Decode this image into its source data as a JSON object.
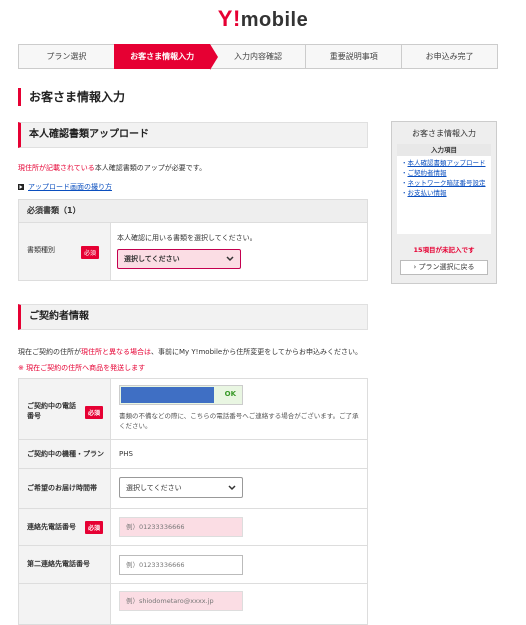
{
  "header": {
    "logo_y": "Y!",
    "logo_text": "mobile"
  },
  "steps": [
    {
      "label": "プラン選択"
    },
    {
      "label": "お客さま情報入力"
    },
    {
      "label": "入力内容確認"
    },
    {
      "label": "重要説明事項"
    },
    {
      "label": "お申込み完了"
    }
  ],
  "page_title": "お客さま情報入力",
  "upload": {
    "heading": "本人確認書類アップロード",
    "note_red": "現住所が記載されている",
    "note_rest": "本人確認書類のアップが必要です。",
    "link": "アップロード画面の撮り方",
    "table_head": "必須書類（1）",
    "doc_label": "書類種別",
    "required": "必須",
    "doc_hint": "本人確認に用いる書類を選択してください。",
    "doc_select": "選択してください"
  },
  "sidebar": {
    "title": "お客さま情報入力",
    "box_head": "入力項目",
    "items": [
      "本人確認書類アップロード",
      "ご契約者情報",
      "ネットワーク暗証番号設定",
      "お支払い情報"
    ],
    "warning": "15項目が未記入です",
    "back_button": "プラン選択に戻る"
  },
  "contract": {
    "heading": "ご契約者情報",
    "note1_pre": "現在ご契約の住所が",
    "note1_red": "現住所と異なる場合は",
    "note1_post": "、事前にMy Y!mobileから住所変更をしてからお申込みください。",
    "note2": "※ 現在ご契約の住所へ商品を発送します",
    "rows": {
      "phone_label": "ご契約中の電話番号",
      "phone_ok": "OK",
      "phone_note": "書類の不備などの際に、こちらの電話番号へご連絡する場合がございます。ご了承ください。",
      "model_label": "ご契約中の機種・プラン",
      "model_value": "PHS",
      "delivery_label": "ご希望のお届け時間帯",
      "delivery_select": "選択してください",
      "contact_label": "連絡先電話番号",
      "contact_placeholder": "例）01233336666",
      "second_label": "第二連絡先電話番号",
      "second_placeholder": "例）01233336666",
      "email_placeholder": "例）shiodometaro@xxxx.jp"
    },
    "required": "必須"
  }
}
